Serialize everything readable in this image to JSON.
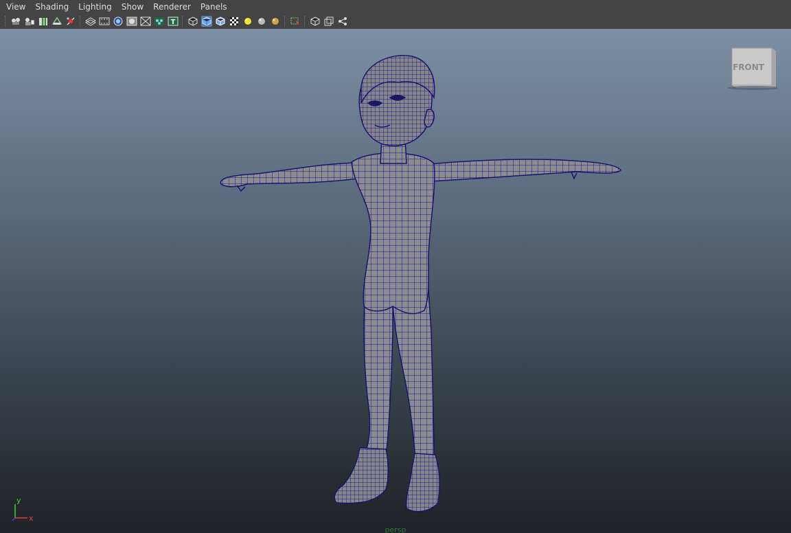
{
  "menu": [
    "View",
    "Shading",
    "Lighting",
    "Show",
    "Renderer",
    "Panels"
  ],
  "toolbar": {
    "groups": [
      [
        "select-camera-icon",
        "camera-attributes-icon",
        "bookmarks-icon",
        "image-plane-icon",
        "2d-pan-zoom-icon"
      ],
      [
        "grid-icon",
        "film-gate-icon",
        "resolution-gate-icon",
        "gate-mask-icon",
        "field-chart-icon",
        "safe-action-icon",
        "safe-title-icon"
      ],
      [
        "wireframe-icon",
        "smooth-shade-icon",
        "wireframe-on-shaded-icon",
        "textured-icon",
        "use-all-lights-icon",
        "shadows-icon",
        "ambient-occlusion-icon"
      ],
      [
        "isolate-select-icon"
      ],
      [
        "xray-icon",
        "xray-joints-icon",
        "xray-components-icon"
      ]
    ],
    "active": [
      "smooth-shade-icon"
    ]
  },
  "viewcube": {
    "label": "FRONT"
  },
  "axis": {
    "y_label": "y",
    "x_label": "x",
    "y_color": "#3cd24a",
    "x_color": "#e0433a"
  },
  "camera_label": "persp",
  "colors": {
    "wire": "#1a1a8c",
    "shade": "#8a8a8e",
    "menubar": "#444444"
  }
}
